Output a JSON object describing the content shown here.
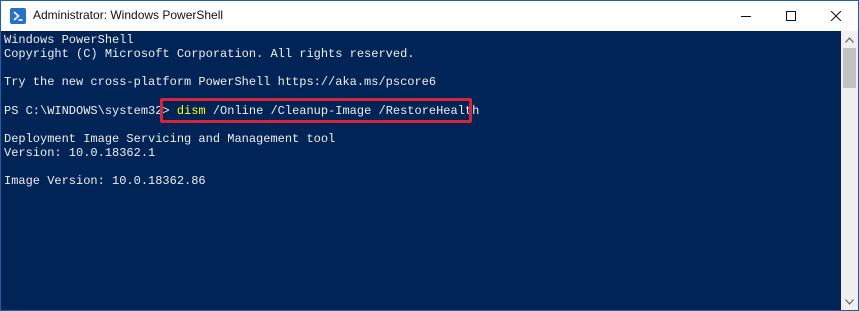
{
  "window": {
    "title": "Administrator: Windows PowerShell",
    "icon": "powershell-icon",
    "controls": [
      "minimize-icon",
      "maximize-icon",
      "close-icon"
    ]
  },
  "colors": {
    "console_bg": "#012456",
    "console_fg": "#eeedf0",
    "command_highlight": "#ffff00",
    "annotation_box": "#d6243a"
  },
  "console": {
    "banner_1": "Windows PowerShell",
    "banner_2": "Copyright (C) Microsoft Corporation. All rights reserved.",
    "banner_3": "Try the new cross-platform PowerShell https://aka.ms/pscore6",
    "prompt": "PS C:\\WINDOWS\\system32>",
    "command_name": "dism",
    "command_args": "/Online /Cleanup-Image /RestoreHealth",
    "output_1": "Deployment Image Servicing and Management tool",
    "output_2": "Version: 10.0.18362.1",
    "output_3": "Image Version: 10.0.18362.86"
  }
}
